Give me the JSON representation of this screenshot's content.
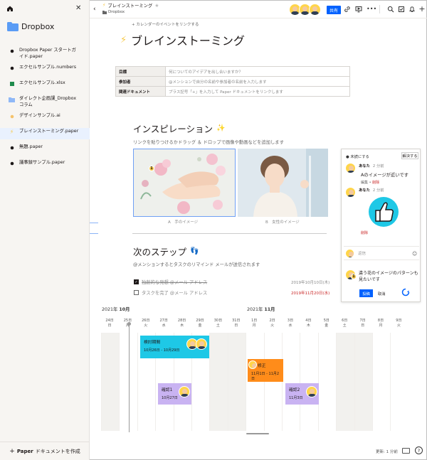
{
  "sidebar": {
    "brand": "Dropbox",
    "items": [
      {
        "label": "Dropbox Paper スタートガイド.paper",
        "icon": "paper-doc-icon"
      },
      {
        "label": "エクセルサンプル.numbers",
        "icon": "numbers-file-icon"
      },
      {
        "label": "エクセルサンプル.xlsx",
        "icon": "excel-file-icon"
      },
      {
        "label": "ダイレクト企画課_Dropboxコラム",
        "icon": "folder-icon"
      },
      {
        "label": "デザインサンプル.ai",
        "icon": "illustrator-file-icon"
      },
      {
        "label": "ブレインストーミング.paper",
        "icon": "bolt-icon"
      },
      {
        "label": "無題.paper",
        "icon": "paper-doc-icon"
      },
      {
        "label": "議事録サンプル.paper",
        "icon": "paper-doc-icon"
      }
    ],
    "new_doc_bold": "Paper",
    "new_doc_rest": "ドキュメントを作成"
  },
  "topbar": {
    "title": "ブレインストーミング",
    "breadcrumb": "Dropbox",
    "share_label": "共有"
  },
  "doc": {
    "calendar_link": "+ カレンダーのイベントをリンクする",
    "title": "ブレインストーミング",
    "meta_rows": [
      {
        "key": "目標",
        "value": "何についてのアイデアを出し合いますか？"
      },
      {
        "key": "参加者",
        "value": "@メンションで自分の名前や参加者の名前を入力します"
      },
      {
        "key": "関連ドキュメント",
        "value": "プラス記号「+」を入力して Paper ドキュメントをリンクします"
      }
    ],
    "inspiration": {
      "heading": "インスピレーション",
      "subtitle": "リンクを貼りつけるかドラッグ ＆ ドロップで画像や動画などを追加します",
      "caption_a": "A　手のイメージ",
      "caption_b": "B　女性のイメージ",
      "comment_badge": "1"
    },
    "next_steps": {
      "heading": "次のステップ",
      "subtitle": "@メンションするとタスクのリマインド メールが送信されます",
      "tasks": [
        {
          "label": "独創的な発想 @メール アドレス",
          "date": "2019年10月10日(木)",
          "done": true
        },
        {
          "label": "タスクを完了 @メール アドレス",
          "date": "2019年11月20日(水)",
          "done": false
        }
      ]
    }
  },
  "timeline": {
    "month1_year": "2021年",
    "month1": "10月",
    "month2_year": "2021年",
    "month2": "11月",
    "days": [
      {
        "d": "24日",
        "w": "日"
      },
      {
        "d": "25日",
        "w": "月"
      },
      {
        "d": "26日",
        "w": "火"
      },
      {
        "d": "27日",
        "w": "水"
      },
      {
        "d": "28日",
        "w": "木"
      },
      {
        "d": "29日",
        "w": "金"
      },
      {
        "d": "30日",
        "w": "土"
      },
      {
        "d": "31日",
        "w": "日"
      },
      {
        "d": "1日",
        "w": "月"
      },
      {
        "d": "2日",
        "w": "火"
      },
      {
        "d": "3日",
        "w": "水"
      },
      {
        "d": "4日",
        "w": "木"
      },
      {
        "d": "5日",
        "w": "金"
      },
      {
        "d": "6日",
        "w": "土"
      },
      {
        "d": "7日",
        "w": "日"
      },
      {
        "d": "8日",
        "w": "月"
      },
      {
        "d": "9日",
        "w": "火"
      }
    ],
    "bars": [
      {
        "label": "検討期間",
        "dates": "10月26日 - 10月29日",
        "color": "#1ec8e6"
      },
      {
        "label": "修正",
        "dates": "11月1日 - 11月2日",
        "color": "#ff8c1a"
      },
      {
        "label": "確認1",
        "dates": "10月27日",
        "color": "#c9b3f2"
      },
      {
        "label": "確認2",
        "dates": "11月3日",
        "color": "#c9b3f2"
      }
    ]
  },
  "comments": {
    "unresolved": "未読にする",
    "resolve": "解決する",
    "c1": {
      "name": "あなた",
      "time": "2 分前",
      "text": "Aのイメージが近いです",
      "edit": "編集",
      "delete": "削除"
    },
    "c2": {
      "name": "あなた",
      "time": "2 分前",
      "delete": "削除"
    },
    "reply_placeholder": "返信",
    "new_badge": "1",
    "new_text": "違う花のイメージのパターンも見たいです",
    "post": "投稿",
    "cancel": "取消"
  },
  "status": {
    "updated": "更新: 1 分前"
  },
  "colors": {
    "accent": "#0061fe",
    "sidebar_bg": "#f7f5f2",
    "active_item_bg": "#e9f1fe"
  }
}
